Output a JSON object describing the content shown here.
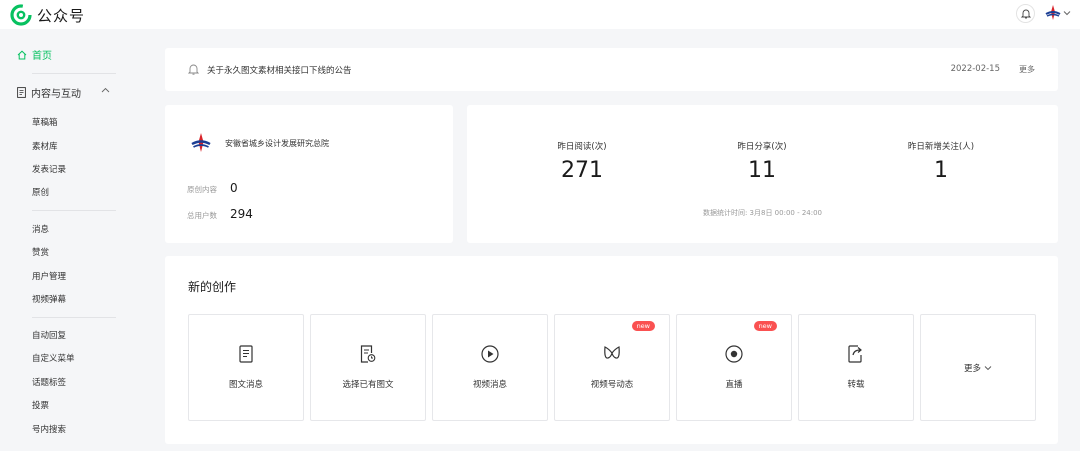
{
  "header": {
    "app_title": "公众号",
    "logo_icon": "wechat-official-account-logo-icon",
    "brand_color": "#07c160"
  },
  "sidebar": {
    "home_label": "首页",
    "group_label": "内容与互动",
    "group1": [
      "草稿箱",
      "素材库",
      "发表记录",
      "原创"
    ],
    "group2": [
      "消息",
      "赞赏",
      "用户管理",
      "视频弹幕"
    ],
    "group3": [
      "自动回复",
      "自定义菜单",
      "话题标签",
      "投票",
      "号内搜索"
    ]
  },
  "notice": {
    "text": "关于永久图文素材相关接口下线的公告",
    "date": "2022-02-15",
    "more_label": "更多"
  },
  "account": {
    "name": "安徽省城乡设计发展研究总院",
    "original_label": "原创内容",
    "original_value": "0",
    "users_label": "总用户数",
    "users_value": "294"
  },
  "stats": {
    "reads_label": "昨日阅读(次)",
    "reads_value": "271",
    "shares_label": "昨日分享(次)",
    "shares_value": "11",
    "follows_label": "昨日新增关注(人)",
    "follows_value": "1",
    "period": "数据统计时间: 3月8日 00:00 - 24:00"
  },
  "create": {
    "title": "新的创作",
    "new_badge": "new",
    "tiles": [
      {
        "label": "图文消息",
        "icon": "document-icon"
      },
      {
        "label": "选择已有图文",
        "icon": "document-clock-icon"
      },
      {
        "label": "视频消息",
        "icon": "play-circle-icon"
      },
      {
        "label": "视频号动态",
        "icon": "channels-icon"
      },
      {
        "label": "直播",
        "icon": "live-icon"
      },
      {
        "label": "转载",
        "icon": "repost-icon"
      },
      {
        "label": "更多",
        "icon": "chevron-down-icon"
      }
    ]
  }
}
